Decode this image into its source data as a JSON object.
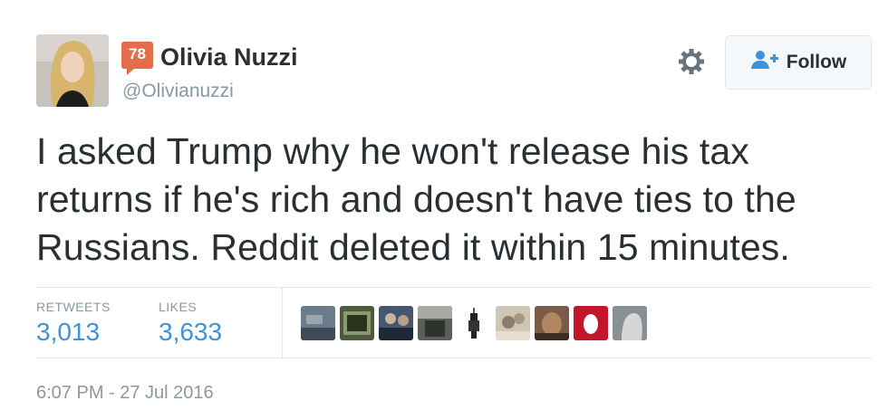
{
  "user": {
    "badge_count": "78",
    "display_name": "Olivia Nuzzi",
    "handle": "@Olivianuzzi"
  },
  "actions": {
    "follow_label": "Follow",
    "settings_icon": "gear-icon",
    "follow_icon": "add-user-icon"
  },
  "tweet": {
    "text": "I asked Trump why he won't release his tax returns if he's rich and doesn't have ties to the Russians. Reddit deleted it within 15 minutes."
  },
  "stats": {
    "retweets_label": "RETWEETS",
    "retweets_value": "3,013",
    "likes_label": "LIKES",
    "likes_value": "3,633"
  },
  "timestamp": "6:07 PM - 27 Jul 2016",
  "colors": {
    "badge": "#e36c4a",
    "stat_value": "#3b94d9",
    "muted": "#8899a6"
  }
}
